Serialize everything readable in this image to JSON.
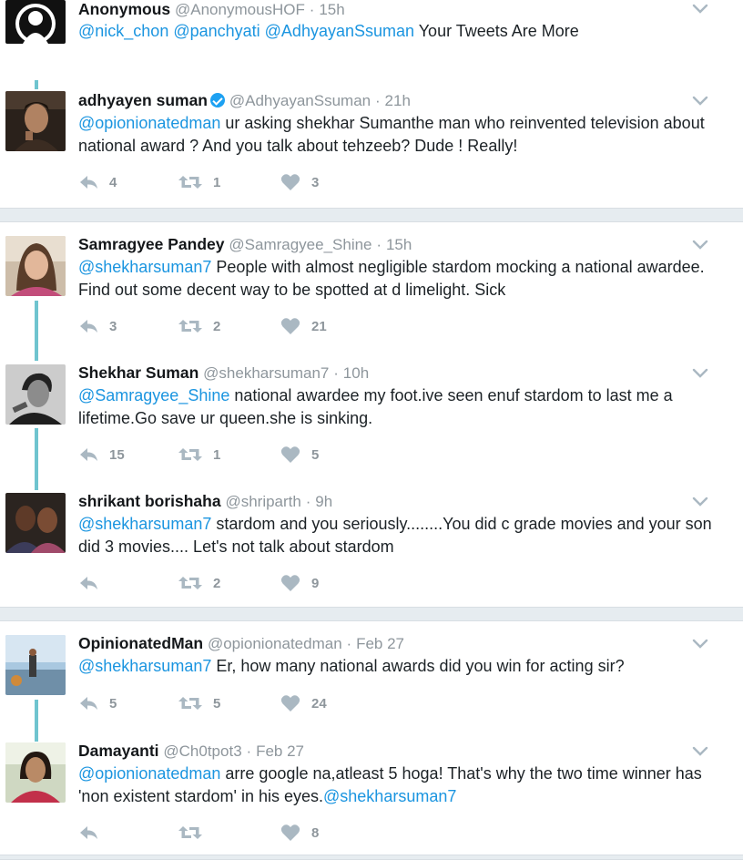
{
  "tweets": [
    {
      "name": "Anonymous",
      "handle": "@AnonymousHOF",
      "time": "15h",
      "body_parts": [
        {
          "t": "@nick_chon @panchyati @AdhyayanSsuman",
          "m": true
        },
        {
          "t": " Your Tweets Are More",
          "m": false
        }
      ],
      "avatar_icon": "anonymous-mask-avatar"
    },
    {
      "name": "adhyayen suman",
      "handle": "@AdhyayanSsuman",
      "time": "21h",
      "verified": true,
      "body_parts": [
        {
          "t": "@opionionatedman",
          "m": true
        },
        {
          "t": " ur asking shekhar Sumanthe man who reinvented television about national award ? And you talk about tehzeeb? Dude ! Really!",
          "m": false
        }
      ],
      "counts": {
        "reply": "4",
        "retweet": "1",
        "like": "3"
      }
    },
    {
      "name": "Samragyee Pandey",
      "handle": "@Samragyee_Shine",
      "time": "15h",
      "body_parts": [
        {
          "t": "@shekharsuman7",
          "m": true
        },
        {
          "t": " People with almost negligible stardom mocking a national awardee. Find out some decent way to be spotted at d limelight. Sick",
          "m": false
        }
      ],
      "counts": {
        "reply": "3",
        "retweet": "2",
        "like": "21"
      }
    },
    {
      "name": "Shekhar Suman",
      "handle": "@shekharsuman7",
      "time": "10h",
      "body_parts": [
        {
          "t": "@Samragyee_Shine",
          "m": true
        },
        {
          "t": " national awardee my foot.ive seen enuf stardom to last me a lifetime.Go save ur queen.she is sinking.",
          "m": false
        }
      ],
      "counts": {
        "reply": "15",
        "retweet": "1",
        "like": "5"
      }
    },
    {
      "name": "shrikant borishaha",
      "handle": "@shriparth",
      "time": "9h",
      "body_parts": [
        {
          "t": "@shekharsuman7",
          "m": true
        },
        {
          "t": " stardom and you seriously........You did c grade movies and your son did 3 movies.... Let's not talk about stardom",
          "m": false
        }
      ],
      "counts": {
        "reply": "",
        "retweet": "2",
        "like": "9"
      }
    },
    {
      "name": "OpinionatedMan",
      "handle": "@opionionatedman",
      "time": "Feb 27",
      "body_parts": [
        {
          "t": "@shekharsuman7",
          "m": true
        },
        {
          "t": " Er, how many national awards did you win for acting sir?",
          "m": false
        }
      ],
      "counts": {
        "reply": "5",
        "retweet": "5",
        "like": "24"
      }
    },
    {
      "name": "Damayanti",
      "handle": "@Ch0tpot3",
      "time": "Feb 27",
      "body_parts": [
        {
          "t": "@opionionatedman",
          "m": true
        },
        {
          "t": " arre google na,atleast 5 hoga! That's why the two time winner has 'non existent stardom' in his eyes.",
          "m": false
        },
        {
          "t": "@shekharsuman7",
          "m": true
        }
      ],
      "counts": {
        "reply": "",
        "retweet": "",
        "like": "8"
      }
    }
  ],
  "separator": "·",
  "colors": {
    "mention": "#1b95e0",
    "thread_line": "#6fc4cf",
    "divider": "#e6ecf0",
    "meta": "#8e969c",
    "verified": "#1da1f2"
  },
  "icons": {
    "reply": "reply-icon",
    "retweet": "retweet-icon",
    "like": "heart-icon",
    "menu": "chevron-down-icon"
  }
}
